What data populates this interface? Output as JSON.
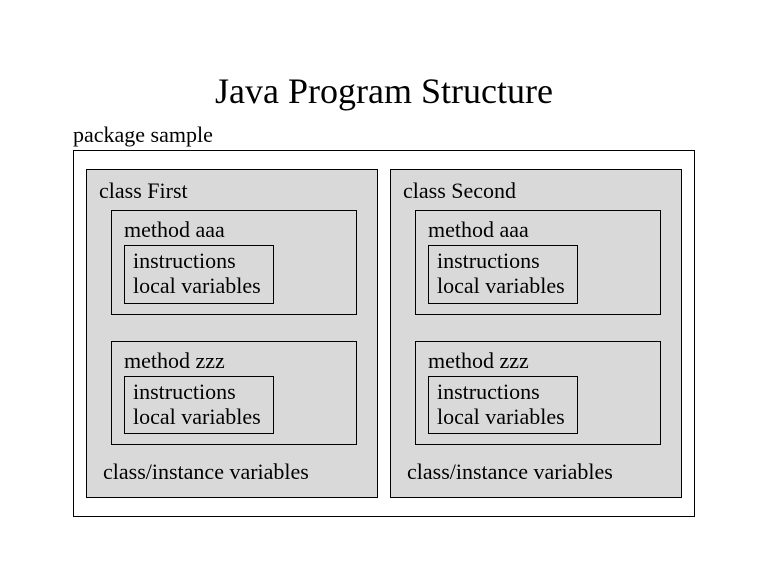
{
  "title": "Java Program Structure",
  "package_label": "package sample",
  "classes": [
    {
      "label": "class First",
      "methods": [
        {
          "label": "method aaa",
          "inner": {
            "line1": "instructions",
            "line2": "local variables"
          }
        },
        {
          "label": "method zzz",
          "inner": {
            "line1": "instructions",
            "line2": "local variables"
          }
        }
      ],
      "vars": "class/instance variables"
    },
    {
      "label": "class Second",
      "methods": [
        {
          "label": "method aaa",
          "inner": {
            "line1": "instructions",
            "line2": "local variables"
          }
        },
        {
          "label": "method zzz",
          "inner": {
            "line1": "instructions",
            "line2": "local variables"
          }
        }
      ],
      "vars": "class/instance variables"
    }
  ]
}
